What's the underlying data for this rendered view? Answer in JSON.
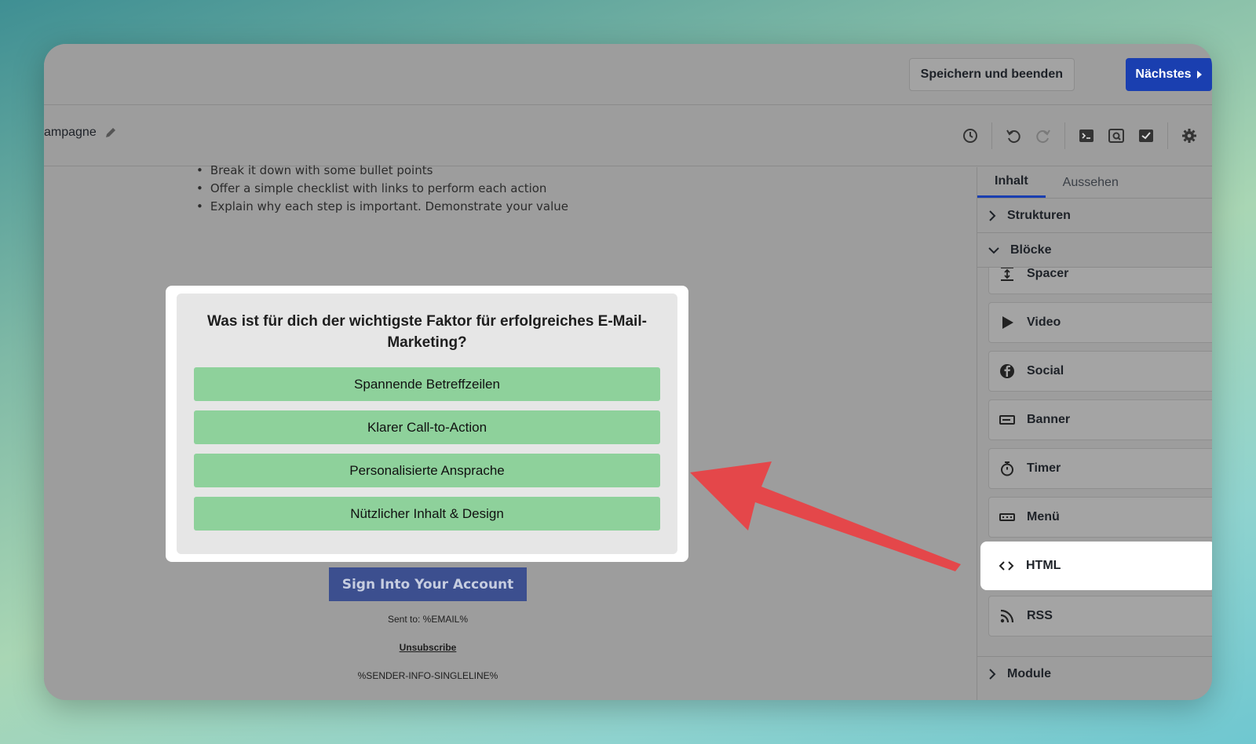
{
  "header": {
    "save_label": "Speichern und beenden",
    "next_label": "Nächstes"
  },
  "toolbar": {
    "campaign_name": "ampagne"
  },
  "email": {
    "bullets": [
      "Break it down with some bullet points",
      "Offer a simple checklist with links to perform each action",
      "Explain why each step is important. Demonstrate your value"
    ],
    "poll": {
      "question": "Was ist für dich der wichtigste Faktor für erfolgreiches E-Mail-Marketing?",
      "options": [
        "Spannende Betreffzeilen",
        "Klarer Call-to-Action",
        "Personalisierte Ansprache",
        "Nützlicher Inhalt & Design"
      ]
    },
    "cta_label": "Sign Into Your Account",
    "sent_to": "Sent to: %EMAIL%",
    "unsubscribe": "Unsubscribe",
    "sender_info": "%SENDER-INFO-SINGLELINE%"
  },
  "sidebar": {
    "tabs": [
      "Inhalt",
      "Aussehen"
    ],
    "sections": {
      "structures": "Strukturen",
      "blocks": "Blöcke",
      "modules": "Module"
    },
    "blocks": [
      {
        "label": "Spacer",
        "icon": "spacer-icon"
      },
      {
        "label": "Video",
        "icon": "play-icon"
      },
      {
        "label": "Social",
        "icon": "facebook-icon"
      },
      {
        "label": "Banner",
        "icon": "banner-icon"
      },
      {
        "label": "Timer",
        "icon": "stopwatch-icon"
      },
      {
        "label": "Menü",
        "icon": "menu-icon"
      },
      {
        "label": "HTML",
        "icon": "code-icon"
      },
      {
        "label": "RSS",
        "icon": "rss-icon"
      }
    ]
  },
  "colors": {
    "primary": "#1a3fb0",
    "poll_option": "#8ed19b",
    "annotation_arrow": "#e4474a"
  }
}
